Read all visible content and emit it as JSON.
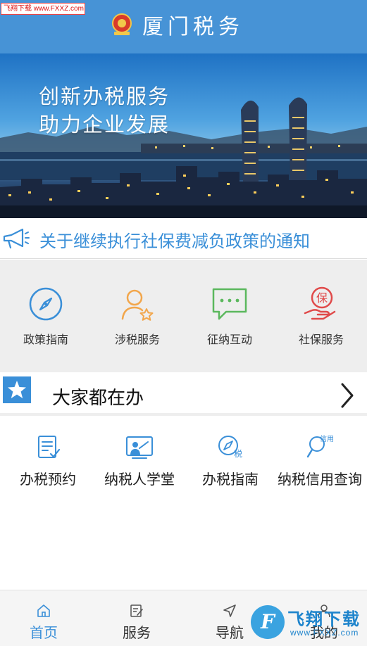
{
  "watermark_top": "飞翔下载 www.FXXZ.com",
  "header": {
    "title": "厦门税务"
  },
  "banner": {
    "line1": "创新办税服务",
    "line2": "助力企业发展"
  },
  "notice": {
    "text": "关于继续执行社保费减负政策的通知"
  },
  "quick_menu": [
    {
      "label": "政策指南",
      "icon": "compass-icon",
      "color": "#3a8fd8"
    },
    {
      "label": "涉税服务",
      "icon": "user-star-icon",
      "color": "#f2a64b"
    },
    {
      "label": "征纳互动",
      "icon": "chat-bubble-icon",
      "color": "#5bb85d"
    },
    {
      "label": "社保服务",
      "icon": "hand-shield-icon",
      "color": "#e04a4a"
    }
  ],
  "popular": {
    "title": "大家都在办"
  },
  "services": [
    {
      "label": "办税预约",
      "icon": "checklist-icon"
    },
    {
      "label": "纳税人学堂",
      "icon": "classroom-icon"
    },
    {
      "label": "办税指南",
      "icon": "compass-tax-icon",
      "icon_text": "税"
    },
    {
      "label": "纳税信用查询",
      "icon": "search-credit-icon",
      "icon_text": "信用"
    }
  ],
  "tabs": [
    {
      "label": "首页",
      "icon": "home-icon",
      "active": true
    },
    {
      "label": "服务",
      "icon": "edit-icon",
      "active": false
    },
    {
      "label": "导航",
      "icon": "navigation-icon",
      "active": false
    },
    {
      "label": "我的",
      "icon": "person-icon",
      "active": false
    }
  ],
  "watermark_bottom": {
    "brand": "飞翔下载",
    "url": "www.FXXZ.com"
  },
  "colors": {
    "header": "#4793d6",
    "accent": "#3a8fd8",
    "grid_bg": "#eeeeee"
  }
}
